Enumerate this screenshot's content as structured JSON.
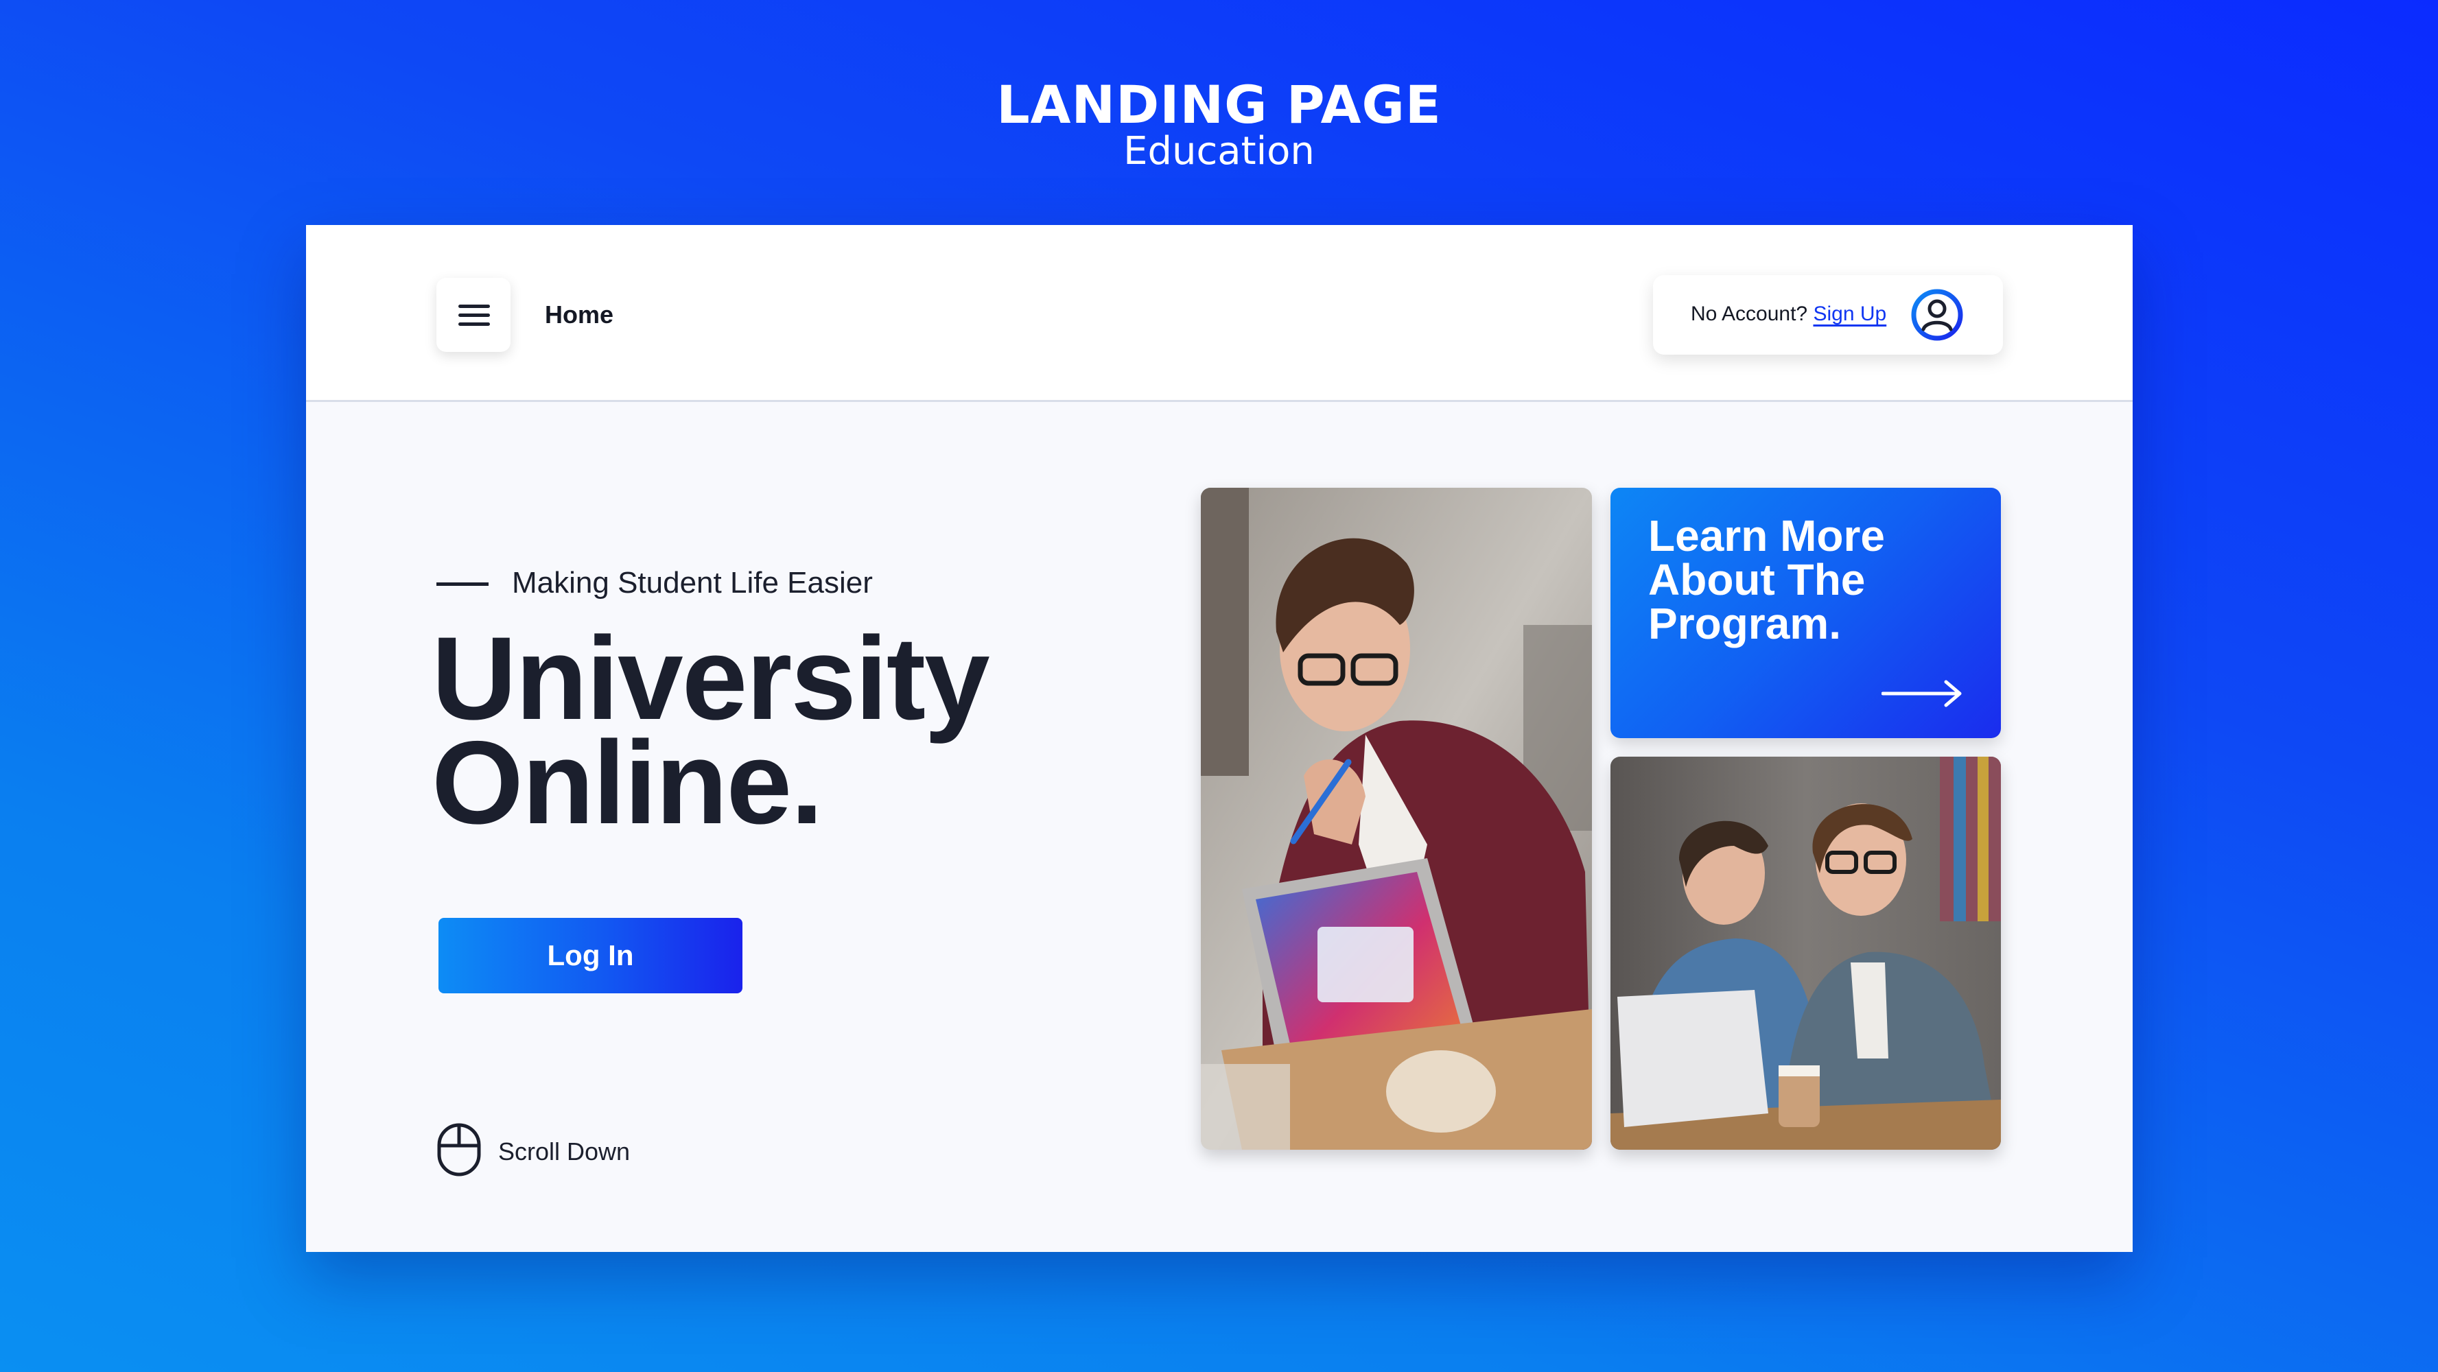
{
  "header": {
    "title": "LANDING PAGE",
    "subtitle": "Education"
  },
  "topbar": {
    "menu_icon": "hamburger-menu-icon",
    "nav_label": "Home",
    "account_prompt": "No Account?",
    "signup_label": "Sign Up",
    "avatar_icon": "user-avatar-icon"
  },
  "hero": {
    "tagline": "Making Student Life Easier",
    "title_line1": "University",
    "title_line2": "Online.",
    "login_label": "Log In",
    "scroll_label": "Scroll Down",
    "scroll_icon": "mouse-icon"
  },
  "promo": {
    "text": "Learn More About The Program.",
    "arrow_icon": "arrow-right-icon"
  },
  "photos": {
    "photo1_icon": "student-laptop-photo",
    "photo2_icon": "students-studying-photo"
  },
  "colors": {
    "accent": "#1036f2",
    "background_top": "#0b2bff",
    "background_bottom": "#0a8ff2",
    "text_dark": "#1b1f2d"
  }
}
